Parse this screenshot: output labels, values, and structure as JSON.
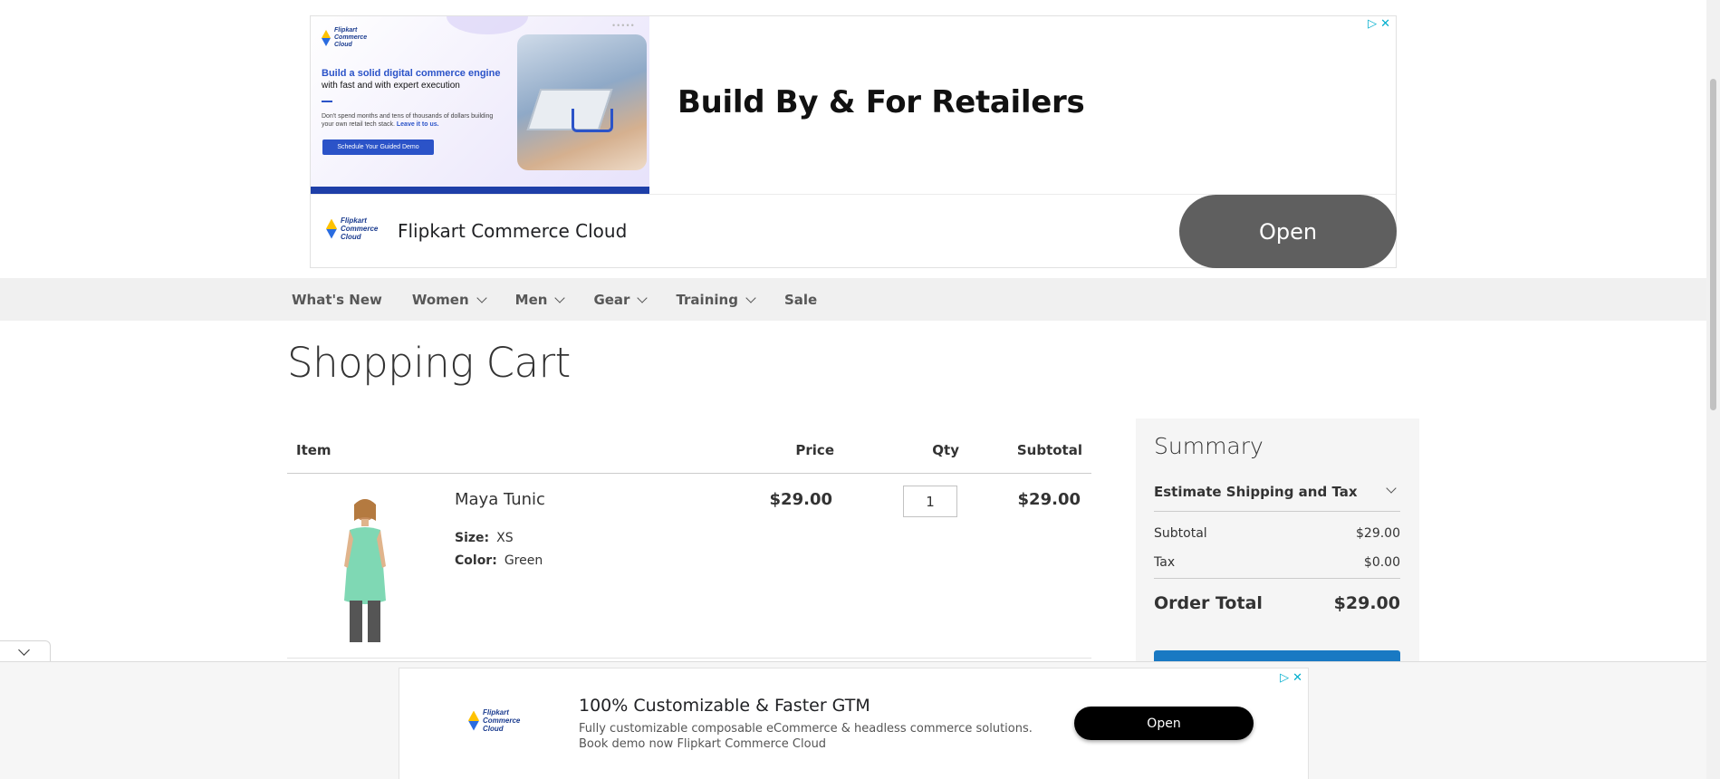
{
  "top_ad": {
    "creative": {
      "logo_line1": "Flipkart",
      "logo_line2": "Commerce",
      "logo_line3": "Cloud",
      "headline": "Build a solid digital commerce engine",
      "subline": "with fast and with expert execution",
      "body": "Don't spend months and tens of thousands of dollars building your own retail tech stack.",
      "body_bold": "Leave it to us.",
      "cta": "Schedule Your Guided Demo",
      "dots": "•••••"
    },
    "headline": "Build By & For Retailers",
    "brand": "Flipkart Commerce Cloud",
    "open_label": "Open",
    "adchoices_icon": "▷",
    "close_icon": "✕"
  },
  "nav": {
    "items": [
      {
        "label": "What's New",
        "has_dropdown": false
      },
      {
        "label": "Women",
        "has_dropdown": true
      },
      {
        "label": "Men",
        "has_dropdown": true
      },
      {
        "label": "Gear",
        "has_dropdown": true
      },
      {
        "label": "Training",
        "has_dropdown": true
      },
      {
        "label": "Sale",
        "has_dropdown": false
      }
    ]
  },
  "page": {
    "title": "Shopping Cart"
  },
  "cart": {
    "headers": {
      "item": "Item",
      "price": "Price",
      "qty": "Qty",
      "subtotal": "Subtotal"
    },
    "items": [
      {
        "name": "Maya Tunic",
        "size_label": "Size:",
        "size_value": "XS",
        "color_label": "Color:",
        "color_value": "Green",
        "price": "$29.00",
        "qty": "1",
        "subtotal": "$29.00",
        "product_color": "#7fd8b4"
      }
    ]
  },
  "summary": {
    "title": "Summary",
    "estimate_label": "Estimate Shipping and Tax",
    "subtotal_label": "Subtotal",
    "subtotal_value": "$29.00",
    "tax_label": "Tax",
    "tax_value": "$0.00",
    "order_total_label": "Order Total",
    "order_total_value": "$29.00"
  },
  "bottom_ad": {
    "logo_line1": "Flipkart",
    "logo_line2": "Commerce",
    "logo_line3": "Cloud",
    "headline": "100% Customizable & Faster GTM",
    "description": "Fully customizable composable eCommerce & headless commerce solutions. Book demo now Flipkart Commerce Cloud",
    "open_label": "Open",
    "adchoices_icon": "▷",
    "close_icon": "✕"
  },
  "colors": {
    "nav_bg": "#f0f0f0",
    "summary_bg": "#f5f5f5",
    "primary_button": "#1979c3",
    "ad_accent": "#00aecd"
  }
}
